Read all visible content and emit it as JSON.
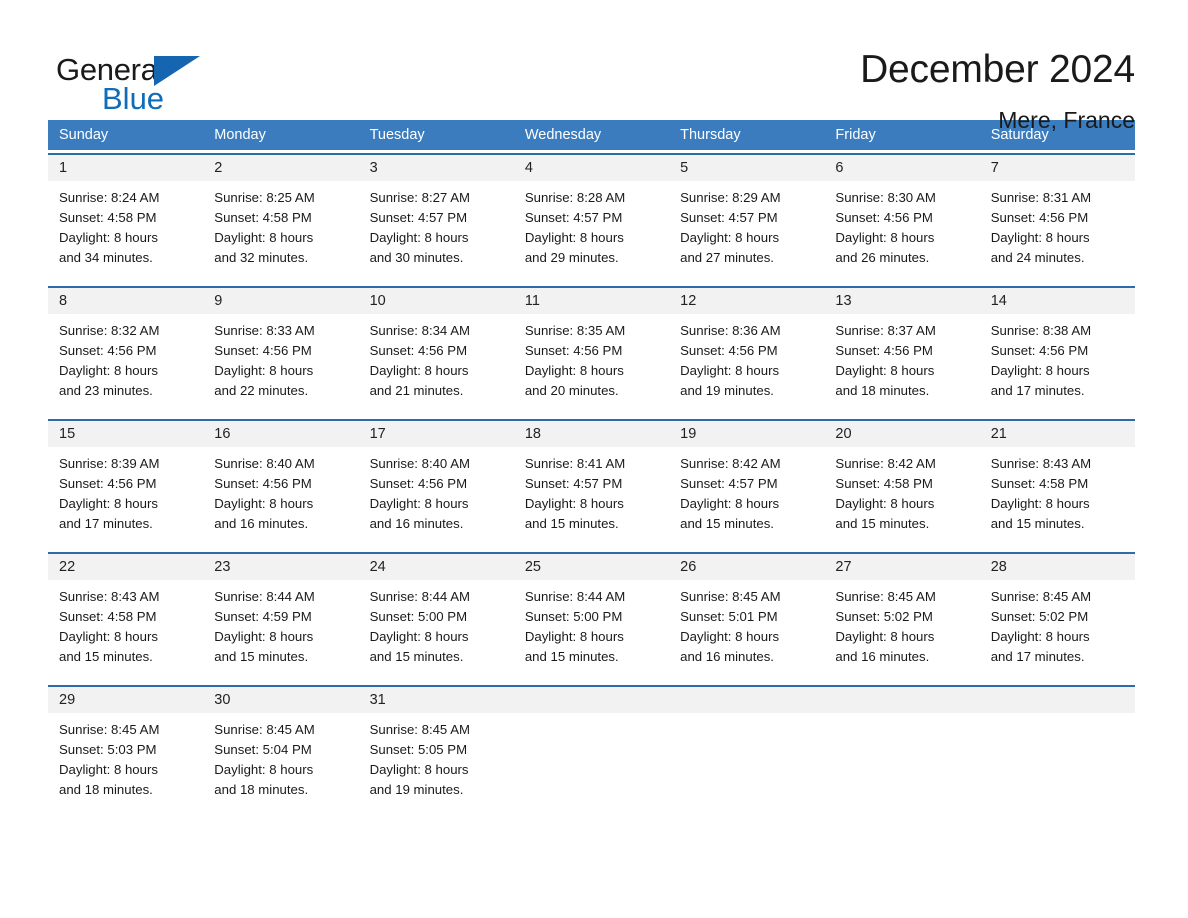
{
  "brand": {
    "name_primary": "General",
    "name_secondary": "Blue",
    "triangle_icon": "triangle-icon",
    "primary_color": "#1a1a1a",
    "secondary_color": "#0f6cb8"
  },
  "header": {
    "title": "December 2024",
    "location": "Mere, France"
  },
  "calendar": {
    "header_bg": "#3a7cbe",
    "row_border_color": "#2e6ca8",
    "daynum_bg": "#f2f2f2",
    "weekdays": [
      "Sunday",
      "Monday",
      "Tuesday",
      "Wednesday",
      "Thursday",
      "Friday",
      "Saturday"
    ],
    "weeks": [
      [
        {
          "day": "1",
          "sunrise": "Sunrise: 8:24 AM",
          "sunset": "Sunset: 4:58 PM",
          "daylight1": "Daylight: 8 hours",
          "daylight2": "and 34 minutes."
        },
        {
          "day": "2",
          "sunrise": "Sunrise: 8:25 AM",
          "sunset": "Sunset: 4:58 PM",
          "daylight1": "Daylight: 8 hours",
          "daylight2": "and 32 minutes."
        },
        {
          "day": "3",
          "sunrise": "Sunrise: 8:27 AM",
          "sunset": "Sunset: 4:57 PM",
          "daylight1": "Daylight: 8 hours",
          "daylight2": "and 30 minutes."
        },
        {
          "day": "4",
          "sunrise": "Sunrise: 8:28 AM",
          "sunset": "Sunset: 4:57 PM",
          "daylight1": "Daylight: 8 hours",
          "daylight2": "and 29 minutes."
        },
        {
          "day": "5",
          "sunrise": "Sunrise: 8:29 AM",
          "sunset": "Sunset: 4:57 PM",
          "daylight1": "Daylight: 8 hours",
          "daylight2": "and 27 minutes."
        },
        {
          "day": "6",
          "sunrise": "Sunrise: 8:30 AM",
          "sunset": "Sunset: 4:56 PM",
          "daylight1": "Daylight: 8 hours",
          "daylight2": "and 26 minutes."
        },
        {
          "day": "7",
          "sunrise": "Sunrise: 8:31 AM",
          "sunset": "Sunset: 4:56 PM",
          "daylight1": "Daylight: 8 hours",
          "daylight2": "and 24 minutes."
        }
      ],
      [
        {
          "day": "8",
          "sunrise": "Sunrise: 8:32 AM",
          "sunset": "Sunset: 4:56 PM",
          "daylight1": "Daylight: 8 hours",
          "daylight2": "and 23 minutes."
        },
        {
          "day": "9",
          "sunrise": "Sunrise: 8:33 AM",
          "sunset": "Sunset: 4:56 PM",
          "daylight1": "Daylight: 8 hours",
          "daylight2": "and 22 minutes."
        },
        {
          "day": "10",
          "sunrise": "Sunrise: 8:34 AM",
          "sunset": "Sunset: 4:56 PM",
          "daylight1": "Daylight: 8 hours",
          "daylight2": "and 21 minutes."
        },
        {
          "day": "11",
          "sunrise": "Sunrise: 8:35 AM",
          "sunset": "Sunset: 4:56 PM",
          "daylight1": "Daylight: 8 hours",
          "daylight2": "and 20 minutes."
        },
        {
          "day": "12",
          "sunrise": "Sunrise: 8:36 AM",
          "sunset": "Sunset: 4:56 PM",
          "daylight1": "Daylight: 8 hours",
          "daylight2": "and 19 minutes."
        },
        {
          "day": "13",
          "sunrise": "Sunrise: 8:37 AM",
          "sunset": "Sunset: 4:56 PM",
          "daylight1": "Daylight: 8 hours",
          "daylight2": "and 18 minutes."
        },
        {
          "day": "14",
          "sunrise": "Sunrise: 8:38 AM",
          "sunset": "Sunset: 4:56 PM",
          "daylight1": "Daylight: 8 hours",
          "daylight2": "and 17 minutes."
        }
      ],
      [
        {
          "day": "15",
          "sunrise": "Sunrise: 8:39 AM",
          "sunset": "Sunset: 4:56 PM",
          "daylight1": "Daylight: 8 hours",
          "daylight2": "and 17 minutes."
        },
        {
          "day": "16",
          "sunrise": "Sunrise: 8:40 AM",
          "sunset": "Sunset: 4:56 PM",
          "daylight1": "Daylight: 8 hours",
          "daylight2": "and 16 minutes."
        },
        {
          "day": "17",
          "sunrise": "Sunrise: 8:40 AM",
          "sunset": "Sunset: 4:56 PM",
          "daylight1": "Daylight: 8 hours",
          "daylight2": "and 16 minutes."
        },
        {
          "day": "18",
          "sunrise": "Sunrise: 8:41 AM",
          "sunset": "Sunset: 4:57 PM",
          "daylight1": "Daylight: 8 hours",
          "daylight2": "and 15 minutes."
        },
        {
          "day": "19",
          "sunrise": "Sunrise: 8:42 AM",
          "sunset": "Sunset: 4:57 PM",
          "daylight1": "Daylight: 8 hours",
          "daylight2": "and 15 minutes."
        },
        {
          "day": "20",
          "sunrise": "Sunrise: 8:42 AM",
          "sunset": "Sunset: 4:58 PM",
          "daylight1": "Daylight: 8 hours",
          "daylight2": "and 15 minutes."
        },
        {
          "day": "21",
          "sunrise": "Sunrise: 8:43 AM",
          "sunset": "Sunset: 4:58 PM",
          "daylight1": "Daylight: 8 hours",
          "daylight2": "and 15 minutes."
        }
      ],
      [
        {
          "day": "22",
          "sunrise": "Sunrise: 8:43 AM",
          "sunset": "Sunset: 4:58 PM",
          "daylight1": "Daylight: 8 hours",
          "daylight2": "and 15 minutes."
        },
        {
          "day": "23",
          "sunrise": "Sunrise: 8:44 AM",
          "sunset": "Sunset: 4:59 PM",
          "daylight1": "Daylight: 8 hours",
          "daylight2": "and 15 minutes."
        },
        {
          "day": "24",
          "sunrise": "Sunrise: 8:44 AM",
          "sunset": "Sunset: 5:00 PM",
          "daylight1": "Daylight: 8 hours",
          "daylight2": "and 15 minutes."
        },
        {
          "day": "25",
          "sunrise": "Sunrise: 8:44 AM",
          "sunset": "Sunset: 5:00 PM",
          "daylight1": "Daylight: 8 hours",
          "daylight2": "and 15 minutes."
        },
        {
          "day": "26",
          "sunrise": "Sunrise: 8:45 AM",
          "sunset": "Sunset: 5:01 PM",
          "daylight1": "Daylight: 8 hours",
          "daylight2": "and 16 minutes."
        },
        {
          "day": "27",
          "sunrise": "Sunrise: 8:45 AM",
          "sunset": "Sunset: 5:02 PM",
          "daylight1": "Daylight: 8 hours",
          "daylight2": "and 16 minutes."
        },
        {
          "day": "28",
          "sunrise": "Sunrise: 8:45 AM",
          "sunset": "Sunset: 5:02 PM",
          "daylight1": "Daylight: 8 hours",
          "daylight2": "and 17 minutes."
        }
      ],
      [
        {
          "day": "29",
          "sunrise": "Sunrise: 8:45 AM",
          "sunset": "Sunset: 5:03 PM",
          "daylight1": "Daylight: 8 hours",
          "daylight2": "and 18 minutes."
        },
        {
          "day": "30",
          "sunrise": "Sunrise: 8:45 AM",
          "sunset": "Sunset: 5:04 PM",
          "daylight1": "Daylight: 8 hours",
          "daylight2": "and 18 minutes."
        },
        {
          "day": "31",
          "sunrise": "Sunrise: 8:45 AM",
          "sunset": "Sunset: 5:05 PM",
          "daylight1": "Daylight: 8 hours",
          "daylight2": "and 19 minutes."
        },
        {
          "day": "",
          "sunrise": "",
          "sunset": "",
          "daylight1": "",
          "daylight2": ""
        },
        {
          "day": "",
          "sunrise": "",
          "sunset": "",
          "daylight1": "",
          "daylight2": ""
        },
        {
          "day": "",
          "sunrise": "",
          "sunset": "",
          "daylight1": "",
          "daylight2": ""
        },
        {
          "day": "",
          "sunrise": "",
          "sunset": "",
          "daylight1": "",
          "daylight2": ""
        }
      ]
    ]
  }
}
